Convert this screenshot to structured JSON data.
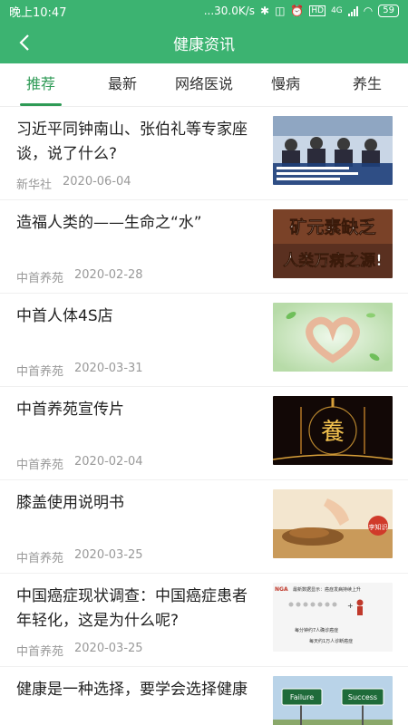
{
  "status_bar": {
    "time": "晚上10:47",
    "speed": "...30.0K/s",
    "network": "4G",
    "battery": "59"
  },
  "header": {
    "title": "健康资讯"
  },
  "tabs": [
    {
      "label": "推荐"
    },
    {
      "label": "最新"
    },
    {
      "label": "网络医说"
    },
    {
      "label": "慢病"
    },
    {
      "label": "养生"
    }
  ],
  "news": [
    {
      "title": "习近平同钟南山、张伯礼等专家座谈，说了什么?",
      "source": "新华社",
      "date": "2020-06-04"
    },
    {
      "title": "造福人类的——生命之“水”",
      "source": "中首养苑",
      "date": "2020-02-28"
    },
    {
      "title": "中首人体4S店",
      "source": "中首养苑",
      "date": "2020-03-31"
    },
    {
      "title": "中首养苑宣传片",
      "source": "中首养苑",
      "date": "2020-02-04"
    },
    {
      "title": "膝盖使用说明书",
      "source": "中首养苑",
      "date": "2020-03-25"
    },
    {
      "title": "中国癌症现状调查：中国癌症患者年轻化，这是为什么呢?",
      "source": "中首养苑",
      "date": "2020-03-25"
    },
    {
      "title": "健康是一种选择，要学会选择健康",
      "source": "",
      "date": ""
    }
  ],
  "thumb_text": {
    "mineral_line1": "矿元素缺乏",
    "mineral_line2": "人类万病之源!",
    "yang": "養",
    "cancer_line1": "最新数据显示：癌症发病持续上升",
    "cancer_line2": "每分钟约7人确诊癌症",
    "cancer_line3": "每天约1万人诊断癌症",
    "cancer_tag": "NGA",
    "failure": "Failure",
    "success": "Success",
    "knee_stamp": "李知识"
  },
  "colors": {
    "brand_green": "#3cb371",
    "tab_active": "#2e9a55"
  }
}
